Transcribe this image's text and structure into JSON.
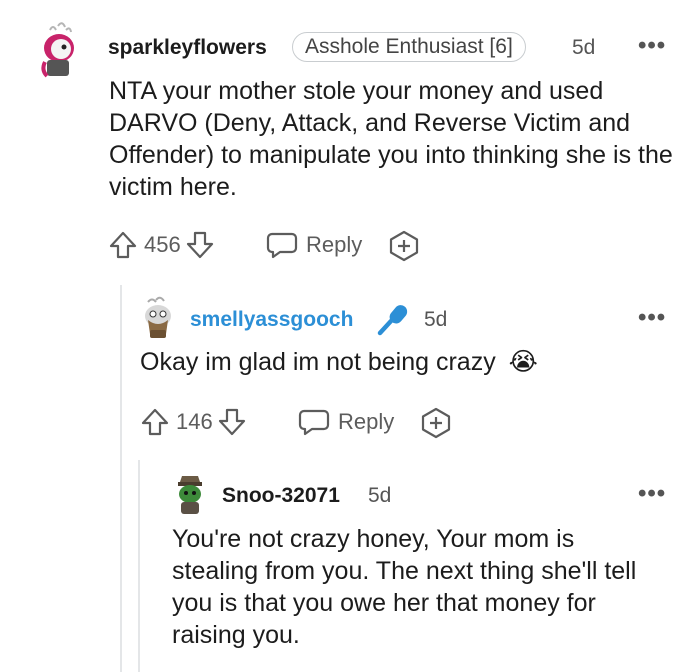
{
  "comments": [
    {
      "username": "sparkleyflowers",
      "flair": "Asshole Enthusiast [6]",
      "time": "5d",
      "menu": "•••",
      "body": "NTA your mother stole your money and used DARVO (Deny, Attack, and Reverse Victim and Offender) to manipulate you into thinking she is the victim here.",
      "votes": "456",
      "reply_label": "Reply"
    },
    {
      "username": "smellyassgooch",
      "time": "5d",
      "menu": "•••",
      "body": "Okay im glad im not being crazy",
      "emoji": "😭",
      "votes": "146",
      "reply_label": "Reply"
    },
    {
      "username": "Snoo-32071",
      "time": "5d",
      "menu": "•••",
      "body": "You're not crazy honey, Your mom is stealing from you. The next thing she'll tell you is that you owe her that money for raising you."
    }
  ],
  "colors": {
    "text": "#1c1c1c",
    "secondary": "#5c5c5c",
    "username_blue": "#2c8fd6",
    "mic_blue": "#2c8fd6",
    "thread_line": "#e4e6e8"
  }
}
